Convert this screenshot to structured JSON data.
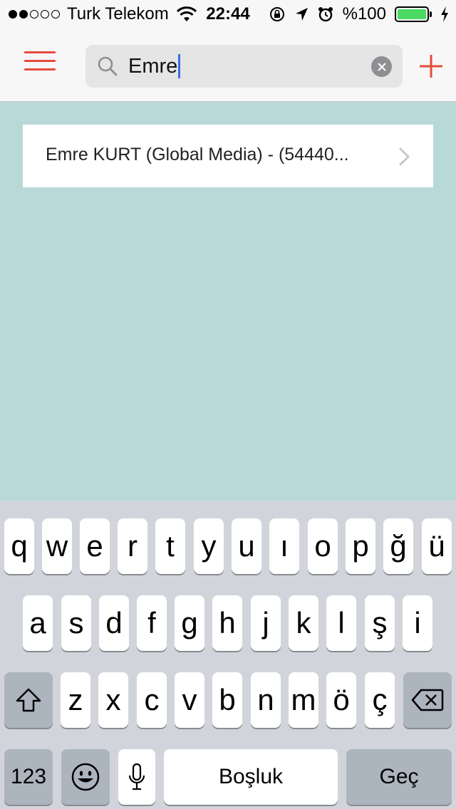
{
  "status_bar": {
    "carrier": "Turk Telekom",
    "time": "22:44",
    "battery_text": "%100",
    "battery_level": 1.0,
    "signal_bars_filled": 2,
    "signal_bars_total": 5
  },
  "nav": {
    "menu_icon": "hamburger-menu-icon",
    "search_icon": "search-icon",
    "search_value": "Emre",
    "clear_icon": "clear-circle-icon",
    "add_icon": "plus-icon",
    "accent_color": "#e64b3c"
  },
  "results": [
    {
      "label": "Emre KURT (Global Media) - (54440...",
      "icon": "chevron-right-icon"
    }
  ],
  "keyboard": {
    "row1": [
      "q",
      "w",
      "e",
      "r",
      "t",
      "y",
      "u",
      "ı",
      "o",
      "p",
      "ğ",
      "ü"
    ],
    "row2": [
      "a",
      "s",
      "d",
      "f",
      "g",
      "h",
      "j",
      "k",
      "l",
      "ş",
      "i"
    ],
    "row3": [
      "z",
      "x",
      "c",
      "v",
      "b",
      "n",
      "m",
      "ö",
      "ç"
    ],
    "shift_icon": "shift-icon",
    "delete_icon": "backspace-icon",
    "numbers_label": "123",
    "emoji_icon": "emoji-icon",
    "mic_icon": "microphone-icon",
    "space_label": "Boşluk",
    "return_label": "Geç"
  },
  "colors": {
    "background": "#b9d9d8",
    "keyboard_bg": "#d1d5db",
    "battery_fill": "#4cd964"
  }
}
